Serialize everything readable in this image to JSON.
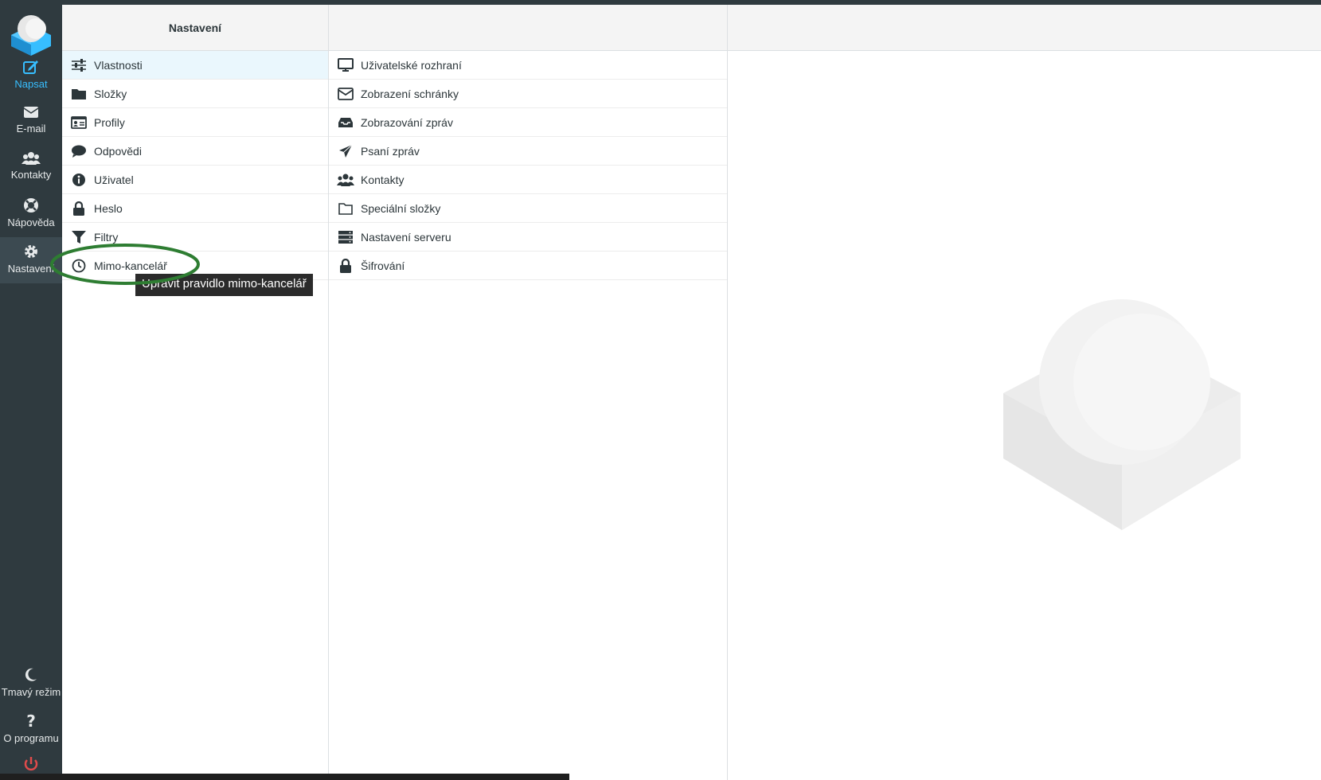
{
  "sidebar": {
    "items": [
      {
        "label": "Napsat",
        "icon": "compose-icon"
      },
      {
        "label": "E-mail",
        "icon": "envelope-icon"
      },
      {
        "label": "Kontakty",
        "icon": "users-icon"
      },
      {
        "label": "Nápověda",
        "icon": "lifebuoy-icon"
      },
      {
        "label": "Nastavení",
        "icon": "gear-icon"
      }
    ],
    "bottom": [
      {
        "label": "Tmavý režim",
        "icon": "moon-icon"
      },
      {
        "label": "O programu",
        "icon": "question-icon"
      },
      {
        "label": "",
        "icon": "power-icon"
      }
    ]
  },
  "settings_panel": {
    "title": "Nastavení",
    "items": [
      {
        "label": "Vlastnosti",
        "icon": "sliders-icon"
      },
      {
        "label": "Složky",
        "icon": "folder-icon"
      },
      {
        "label": "Profily",
        "icon": "id-card-icon"
      },
      {
        "label": "Odpovědi",
        "icon": "comment-icon"
      },
      {
        "label": "Uživatel",
        "icon": "info-icon"
      },
      {
        "label": "Heslo",
        "icon": "lock-icon"
      },
      {
        "label": "Filtry",
        "icon": "filter-icon"
      },
      {
        "label": "Mimo-kancelář",
        "icon": "clock-icon"
      }
    ]
  },
  "sections_panel": {
    "items": [
      {
        "label": "Uživatelské rozhraní",
        "icon": "monitor-icon"
      },
      {
        "label": "Zobrazení schránky",
        "icon": "envelope-outline-icon"
      },
      {
        "label": "Zobrazování zpráv",
        "icon": "inbox-icon"
      },
      {
        "label": "Psaní zpráv",
        "icon": "paper-plane-icon"
      },
      {
        "label": "Kontakty",
        "icon": "users-icon"
      },
      {
        "label": "Speciální složky",
        "icon": "folder-outline-icon"
      },
      {
        "label": "Nastavení serveru",
        "icon": "server-icon"
      },
      {
        "label": "Šifrování",
        "icon": "lock-icon"
      }
    ]
  },
  "tooltip": {
    "text": "Upravit pravidlo mimo-kancelář"
  },
  "colors": {
    "accent": "#37beff",
    "sidebar": "#2f3a3f",
    "selected_row": "#eaf7fd",
    "annotation": "#2e7d32",
    "logout": "#e04b4b"
  }
}
